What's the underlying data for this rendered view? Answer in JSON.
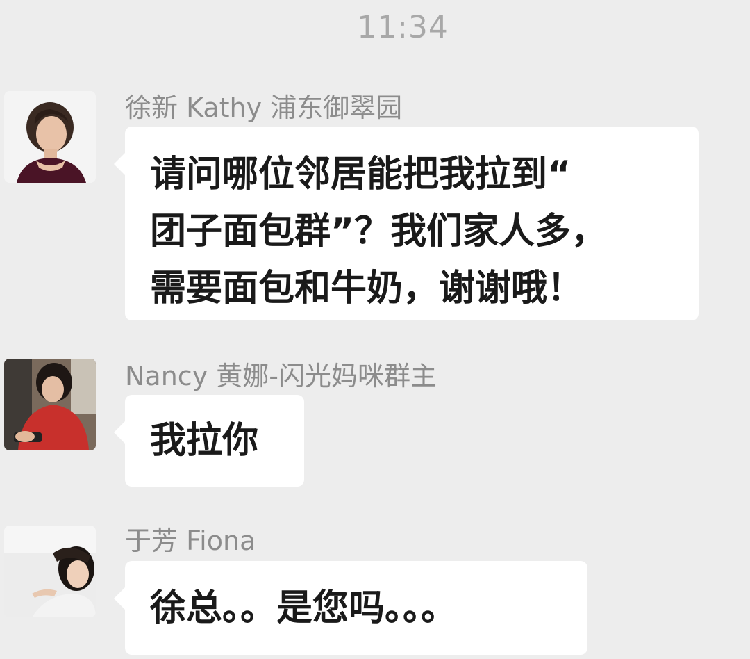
{
  "time": "11:34",
  "messages": [
    {
      "sender": "徐新 Kathy 浦东御翠园",
      "avatar": "avatar-woman-dark-top",
      "lines": [
        "请问哪位邻居能把我拉到“",
        "团子面包群”？我们家人多，",
        "需要面包和牛奶，谢谢哦！"
      ]
    },
    {
      "sender": "Nancy 黄娜-闪光妈咪群主",
      "avatar": "avatar-woman-red-dress",
      "lines": [
        "我拉你"
      ]
    },
    {
      "sender": "于芳 Fiona",
      "avatar": "avatar-woman-smiling",
      "lines": [
        "徐总。。是您吗。。。"
      ]
    }
  ],
  "colors": {
    "background": "#ededed",
    "bubble": "#ffffff",
    "sender_text": "#8c8c8c",
    "timestamp_text": "#a8a8a8"
  }
}
